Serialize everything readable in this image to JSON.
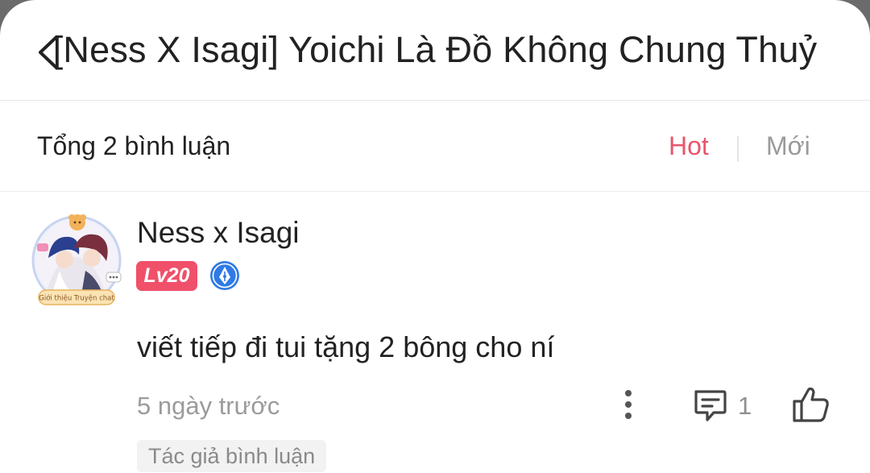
{
  "header": {
    "title": "[Ness X Isagi] Yoichi Là Đồ Không Chung Thuỷ"
  },
  "summary": {
    "total_label": "Tổng 2 bình luận",
    "sort_hot": "Hot",
    "sort_new": "Mới"
  },
  "comment": {
    "username": "Ness x Isagi",
    "level": "Lv20",
    "avatar_caption": "Giới thiệu Truyện chat",
    "text": "viết tiếp đi tui tặng 2 bông cho ní",
    "time": "5 ngày trước",
    "reply_count": "1",
    "author_tag": "Tác giả bình luận"
  },
  "colors": {
    "accent": "#e8566b",
    "badge": "#f0506a",
    "muted": "#9b9b9b",
    "text": "#222222"
  },
  "icons": [
    "back-icon",
    "pen-badge-icon",
    "more-icon",
    "reply-icon",
    "like-icon"
  ]
}
